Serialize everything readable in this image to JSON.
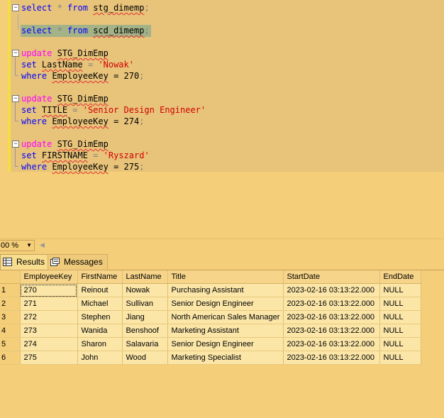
{
  "editor": {
    "lines": [
      [
        {
          "t": "select",
          "c": "kw"
        },
        {
          "t": " * ",
          "c": "op"
        },
        {
          "t": "from",
          "c": "kw"
        },
        {
          "t": " "
        },
        {
          "t": "stg_dimemp",
          "c": "sq"
        },
        {
          "t": ";",
          "c": "op"
        }
      ],
      [],
      [
        {
          "t": "select",
          "c": "kw"
        },
        {
          "t": " * ",
          "c": "op"
        },
        {
          "t": "from",
          "c": "kw"
        },
        {
          "t": " "
        },
        {
          "t": "scd_dimemp",
          "c": "sq"
        },
        {
          "t": ";",
          "c": "op"
        }
      ],
      [],
      [
        {
          "t": "update",
          "c": "kw2"
        },
        {
          "t": " "
        },
        {
          "t": "STG_DimEmp",
          "c": "sq"
        }
      ],
      [
        {
          "t": "set",
          "c": "kw"
        },
        {
          "t": " "
        },
        {
          "t": "LastName",
          "c": "sq"
        },
        {
          "t": " = ",
          "c": "op"
        },
        {
          "t": "'Nowak'",
          "c": "str"
        }
      ],
      [
        {
          "t": "where",
          "c": "kw"
        },
        {
          "t": " "
        },
        {
          "t": "EmployeeKey",
          "c": "sq"
        },
        {
          "t": " = 270"
        },
        {
          "t": ";",
          "c": "op"
        }
      ],
      [],
      [
        {
          "t": "update",
          "c": "kw2"
        },
        {
          "t": " "
        },
        {
          "t": "STG_DimEmp",
          "c": "sq"
        }
      ],
      [
        {
          "t": "set",
          "c": "kw"
        },
        {
          "t": " "
        },
        {
          "t": "TITLE",
          "c": "sq"
        },
        {
          "t": " = ",
          "c": "op"
        },
        {
          "t": "'Senior Design Engineer'",
          "c": "str"
        }
      ],
      [
        {
          "t": "where",
          "c": "kw"
        },
        {
          "t": " "
        },
        {
          "t": "EmployeeKey",
          "c": "sq"
        },
        {
          "t": " = 274"
        },
        {
          "t": ";",
          "c": "op"
        }
      ],
      [],
      [
        {
          "t": "update",
          "c": "kw2"
        },
        {
          "t": " "
        },
        {
          "t": "STG_DimEmp",
          "c": "sq"
        }
      ],
      [
        {
          "t": "set",
          "c": "kw"
        },
        {
          "t": " "
        },
        {
          "t": "FIRSTNAME",
          "c": "sq"
        },
        {
          "t": " = ",
          "c": "op"
        },
        {
          "t": "'Ryszard'",
          "c": "str"
        }
      ],
      [
        {
          "t": "where",
          "c": "kw"
        },
        {
          "t": " "
        },
        {
          "t": "EmployeeKey",
          "c": "sq"
        },
        {
          "t": " = 275"
        },
        {
          "t": ";",
          "c": "op"
        }
      ]
    ]
  },
  "zoom": {
    "label": "00 %"
  },
  "tabs": {
    "results": "Results",
    "messages": "Messages"
  },
  "grid": {
    "columns": [
      "EmployeeKey",
      "FirstName",
      "LastName",
      "Title",
      "StartDate",
      "EndDate"
    ],
    "rows": [
      [
        "1",
        "270",
        "Reinout",
        "Nowak",
        "Purchasing Assistant",
        "2023-02-16 03:13:22.000",
        "NULL"
      ],
      [
        "2",
        "271",
        "Michael",
        "Sullivan",
        "Senior Design Engineer",
        "2023-02-16 03:13:22.000",
        "NULL"
      ],
      [
        "3",
        "272",
        "Stephen",
        "Jiang",
        "North American Sales Manager",
        "2023-02-16 03:13:22.000",
        "NULL"
      ],
      [
        "4",
        "273",
        "Wanida",
        "Benshoof",
        "Marketing Assistant",
        "2023-02-16 03:13:22.000",
        "NULL"
      ],
      [
        "5",
        "274",
        "Sharon",
        "Salavaria",
        "Senior Design Engineer",
        "2023-02-16 03:13:22.000",
        "NULL"
      ],
      [
        "6",
        "275",
        "John",
        "Wood",
        "Marketing Specialist",
        "2023-02-16 03:13:22.000",
        "NULL"
      ]
    ]
  }
}
